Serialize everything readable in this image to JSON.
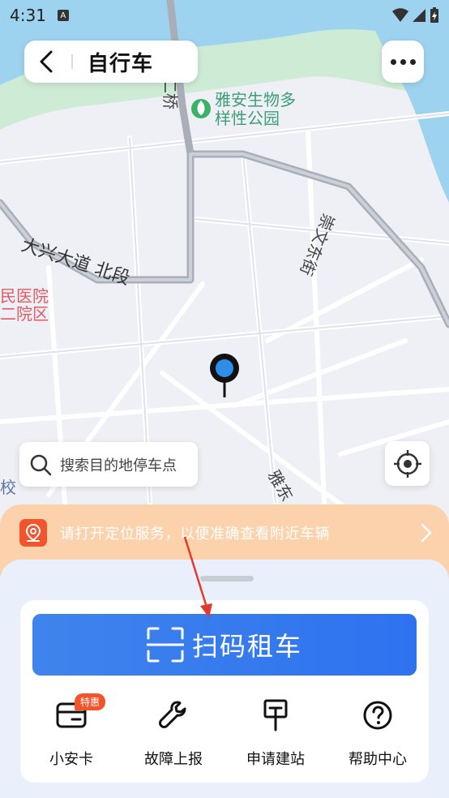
{
  "status_bar": {
    "time": "4:31"
  },
  "header": {
    "title": "自行车"
  },
  "map": {
    "labels": {
      "park_line1": "雅安生物多",
      "park_line2": "样性公园",
      "bridge": "大兴二桥",
      "road_daxing": "大兴大道 北段",
      "road_chongwen": "崇文东街",
      "road_yadong": "雅东",
      "hospital_line1": "民医院",
      "hospital_line2": "二院区",
      "school": "校"
    }
  },
  "search": {
    "placeholder": "搜索目的地停车点"
  },
  "notice": {
    "text": "请打开定位服务，以便准确查看附近车辆"
  },
  "main": {
    "scan_label": "扫码租车",
    "menu": [
      {
        "label": "小安卡",
        "icon": "card-icon",
        "badge": "特惠"
      },
      {
        "label": "故障上报",
        "icon": "wrench-icon"
      },
      {
        "label": "申请建站",
        "icon": "station-sign-icon"
      },
      {
        "label": "帮助中心",
        "icon": "help-icon"
      }
    ]
  },
  "colors": {
    "primary": "#2e72f0",
    "notice_bg": "#fcd2ad",
    "notice_icon": "#f2552c",
    "river": "#9ed3ef",
    "park": "#cdebd5"
  }
}
